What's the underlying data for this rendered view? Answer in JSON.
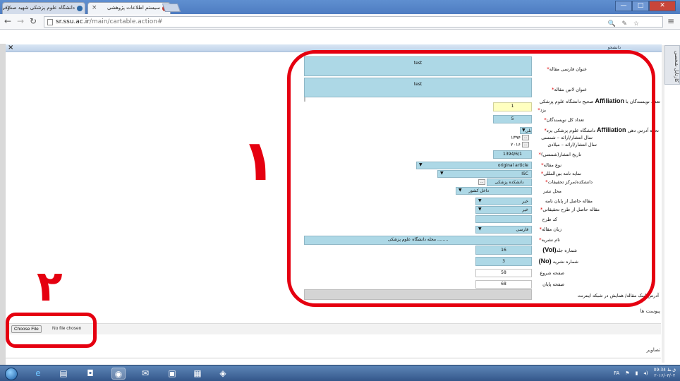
{
  "browser": {
    "tabs": [
      {
        "title": "دانشگاه علوم پزشکی شهید صدوقی",
        "active": false
      },
      {
        "title": "سیستم اطلاعات پژوهشی",
        "active": true
      }
    ],
    "url_host": "sr.ssu.ac.ir",
    "url_path": "/main/cartable.action#",
    "window_buttons": {
      "minimize": "—",
      "maximize": "□",
      "close": "✕"
    }
  },
  "page": {
    "close_symbol": "×",
    "header_tab": "دانشجو",
    "side_tab": "کارتابل شخصی"
  },
  "form": {
    "title_fa": {
      "label": "عنوان فارسی مقاله",
      "value": "test"
    },
    "title_en": {
      "label": "عنوان لاتین مقاله",
      "value": "test"
    },
    "affiliation_count": {
      "label_pre": "تعداد نویسندگان با ",
      "label_word": "Affiliation",
      "label_post": " صحیح دانشگاه علوم پزشکی",
      "label_line2": "یزد",
      "value": "1"
    },
    "total_authors": {
      "label": "تعداد کل نویسندگان",
      "value": "5"
    },
    "address_mode": {
      "label_pre": "نحوه آدرس دهی ",
      "label_word": "Affiliation",
      "label_post": " دانشگاه علوم پزشکی یزد",
      "value": "بلی"
    },
    "pub_year_sh": {
      "label": "سال انتشار/ارائه – شمسی",
      "value": "۱۳۹۴"
    },
    "pub_year_ad": {
      "label": "سال انتشار/ارائه – میلادی",
      "value": "۲۰۱۶"
    },
    "pub_date": {
      "label": "تاریخ انتشار(شمسی)",
      "value": "1394/6/1"
    },
    "article_type": {
      "label": "نوع مقاله",
      "value": "original article"
    },
    "intl_index": {
      "label": "نمایه نامه بین‌المللی",
      "value": "ISC"
    },
    "faculty": {
      "label": "دانشکده/مرکز تحقیقات",
      "value": "دانشکده پزشکی"
    },
    "pub_place": {
      "label": "محل نشر",
      "value": "داخل کشور"
    },
    "from_thesis": {
      "label": "مقاله حاصل از پایان نامه",
      "value": "خیر"
    },
    "from_research": {
      "label": "مقاله حاصل از طرح تحقیقاتی",
      "value": "خیر"
    },
    "plan_code": {
      "label": "کد طرح",
      "value": ""
    },
    "language": {
      "label": "زبان مقاله",
      "value": "فارسی"
    },
    "journal": {
      "label": "نام نشریه",
      "value": "مجله دانشگاه علوم پزشکی ........"
    },
    "volume": {
      "label_pre": "شماره جلد",
      "label_word": "(Vol)",
      "value": "16"
    },
    "issue": {
      "label_pre": "شماره نشریه ",
      "label_word": "(No)",
      "value": "3"
    },
    "start_page": {
      "label": "صفحه شروع",
      "value": "58"
    },
    "end_page": {
      "label": "صفحه پایان",
      "value": "68"
    },
    "link": {
      "label": "آدرس لینک مقاله/ همایش در شبکه اینترنت",
      "value": ""
    }
  },
  "attachments": {
    "title": "پیوست ها",
    "choose_label": "Choose File",
    "status": "No file chosen"
  },
  "images_section": {
    "title": "تصاویر"
  },
  "annotations": {
    "one": "۱",
    "two": "۲",
    "color": "#e50010"
  },
  "taskbar": {
    "lang": "FA",
    "time": "09:34 ق.ظ",
    "date": "۲۰۱۶/۰۳/۰۲"
  }
}
